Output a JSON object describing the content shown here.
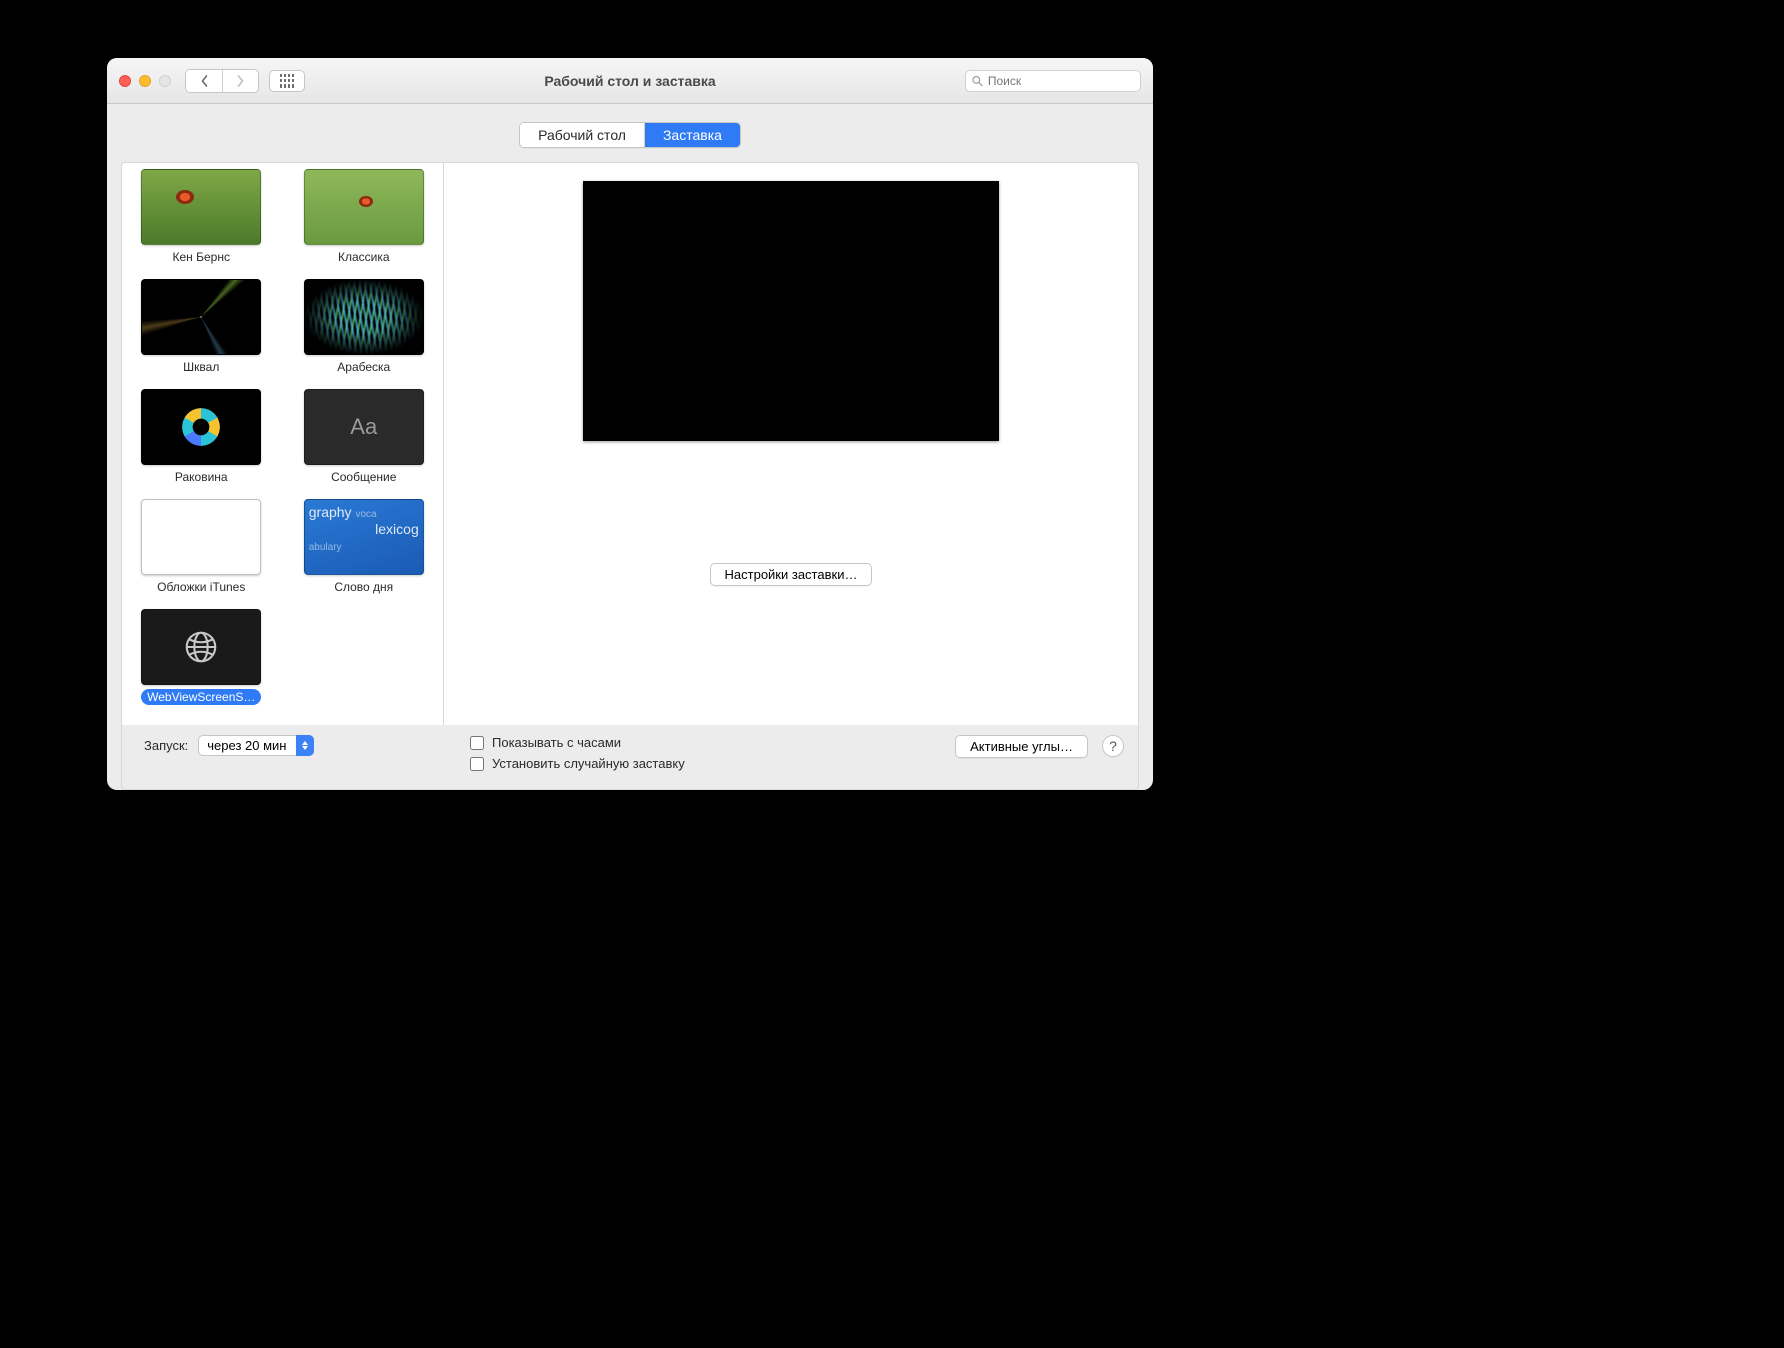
{
  "window": {
    "title": "Рабочий стол и заставка",
    "search_placeholder": "Поиск"
  },
  "tabs": {
    "desktop": "Рабочий стол",
    "screensaver": "Заставка",
    "active": "screensaver"
  },
  "savers": [
    {
      "id": "ken-burns",
      "label": "Кен Бернс",
      "thumb": "t-ken"
    },
    {
      "id": "classic",
      "label": "Классика",
      "thumb": "t-classic"
    },
    {
      "id": "shkval",
      "label": "Шквал",
      "thumb": "t-shkval"
    },
    {
      "id": "arabesque",
      "label": "Арабеска",
      "thumb": "t-arab"
    },
    {
      "id": "shell",
      "label": "Раковина",
      "thumb": "t-rak"
    },
    {
      "id": "message",
      "label": "Сообщение",
      "thumb": "t-msg"
    },
    {
      "id": "itunes-artwork",
      "label": "Обложки iTunes",
      "thumb": "t-itunes"
    },
    {
      "id": "word-of-day",
      "label": "Слово дня",
      "thumb": "t-word"
    },
    {
      "id": "webview",
      "label": "WebViewScreenS…",
      "thumb": "t-web",
      "selected": true
    }
  ],
  "preview": {
    "options_button": "Настройки заставки…"
  },
  "footer": {
    "start_label": "Запуск:",
    "start_value": "через 20 мин",
    "show_clock": "Показывать с часами",
    "random": "Установить случайную заставку",
    "hot_corners": "Активные углы…",
    "help": "?"
  }
}
